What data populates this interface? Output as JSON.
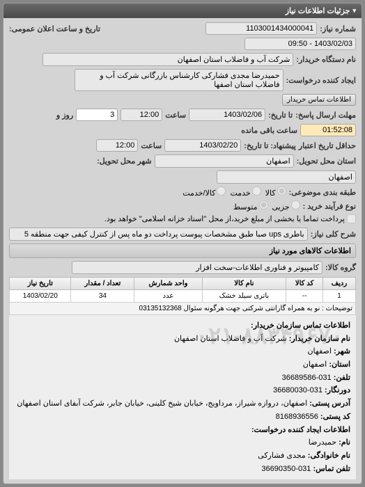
{
  "panel": {
    "title": "جزئیات اطلاعات نیاز"
  },
  "fields": {
    "req_no_label": "شماره نیاز:",
    "req_no": "1103001434000041",
    "announce_label": "تاریخ و ساعت اعلان عمومی:",
    "announce_val": "1403/02/03 - 09:50",
    "buyer_org_label": "نام دستگاه خریدار:",
    "buyer_org": "شرکت آب و فاضلاب استان اصفهان",
    "requester_label": "ایجاد کننده درخواست:",
    "requester": "حمیدرضا مجدی فشارکی کارشناس بازرگانی شرکت آب و فاضلاب استان اصفها",
    "contact_btn": "اطلاعات تماس خریدار",
    "deadline_label": "مهلت ارسال پاسخ:",
    "deadline_to_label": "تا تاریخ:",
    "validity_from_label": "حداقل تاریخ اعتبار",
    "validity_to_label": "پیشنهاد: تا تاریخ:",
    "date1": "1403/02/06",
    "date2": "1403/02/20",
    "time_label": "ساعت",
    "time1": "12:00",
    "time2": "12:00",
    "days_label": "روز و",
    "days_val": "3",
    "remain_label": "ساعت باقی مانده",
    "remain_val": "01:52:08",
    "delivery_state_label": "استان محل تحویل:",
    "delivery_state": "اصفهان",
    "delivery_city_label": "شهر محل تحویل:",
    "delivery_city": "اصفهان",
    "subject_type_label": "طبقه بندی موضوعی:",
    "rb_goods": "کالا",
    "rb_service": "خدمت",
    "rb_goods_service": "کالا/خدمت",
    "purchase_type_label": "نوع فرآیند خرید :",
    "rb_minor": "جزیی",
    "rb_medium": "متوسط",
    "purchase_note": "پرداخت تماما یا بخشی از مبلغ خرید،از محل \"اسناد خزانه اسلامی\" خواهد بود.",
    "need_title_label": "شرح کلی نیاز:",
    "need_title": "باطری ups صبا طبق مشخصات پیوست پرداخت دو ماه پس از کنترل کیفی جهت منطقه 5",
    "items_section": "اطلاعات کالاهای مورد نیاز",
    "group_label": "گروه کالا:",
    "group_val": "کامپیوتر و فناوری اطلاعات-سخت افزار"
  },
  "table": {
    "headers": {
      "row": "ردیف",
      "code": "کد کالا",
      "name": "نام کالا",
      "unit": "واحد شمارش",
      "qty": "تعداد / مقدار",
      "need_date": "تاریخ نیاز"
    },
    "rows": [
      {
        "row": "1",
        "code": "--",
        "name": "باتری سیلد خشک",
        "unit": "عدد",
        "qty": "34",
        "need_date": "1403/02/20"
      }
    ],
    "footer_label": "توضیحات :",
    "footer_text": "نو به همراه گارانتی شرکتی جهت هرگونه سئوال 03135132368"
  },
  "contact": {
    "section": "اطلاعات تماس سازمان خریدار:",
    "org_name_label": "نام سازمان خریدار:",
    "org_name": "شرکت آب و فاضلاب استان اصفهان",
    "city_label": "شهر:",
    "city": "اصفهان",
    "province_label": "استان:",
    "province": "اصفهان",
    "phone_label": "تلفن:",
    "phone": "031-36689586",
    "fax_label": "دورنگار:",
    "fax": "031-36680030",
    "address_label": "آدرس پستی:",
    "address": "اصفهان، دروازه شیراز، مرداویج، خیابان شیخ کلینی، خیابان جابر، شرکت آبفای استان اصفهان",
    "postcode_label": "کد پستی:",
    "postcode": "8168936556",
    "requester_section": "اطلاعات ایجاد کننده درخواست:",
    "name_label": "نام:",
    "name": "حمیدرضا",
    "family_label": "نام خانوادگی:",
    "family": "مجدی فشارکی",
    "req_phone_label": "تلفن تماس:",
    "req_phone": "031-36690350",
    "watermark": "۰۲۱-۸۸۳۴۹۶۷۰"
  }
}
